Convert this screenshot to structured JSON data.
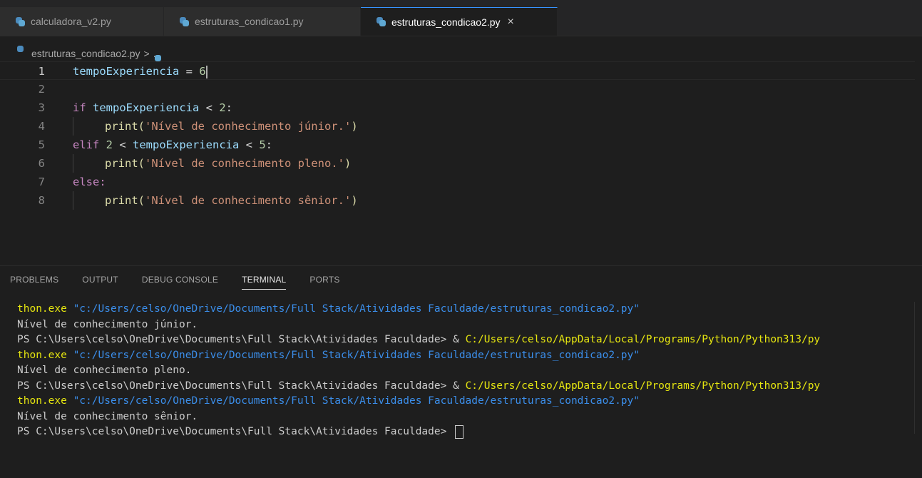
{
  "tabs": [
    {
      "label": "calculadora_v2.py",
      "active": false
    },
    {
      "label": "estruturas_condicao1.py",
      "active": false
    },
    {
      "label": "estruturas_condicao2.py",
      "active": true
    }
  ],
  "close_icon": "×",
  "breadcrumb": {
    "file": "estruturas_condicao2.py",
    "separator": ">",
    "rest": "..."
  },
  "editor": {
    "line_numbers": [
      "1",
      "2",
      "3",
      "4",
      "5",
      "6",
      "7",
      "8"
    ],
    "lines": [
      {
        "var": "tempoExperiencia",
        "op": " = ",
        "num": "6"
      },
      {},
      {
        "kw": "if",
        "var": "tempoExperiencia",
        "op": " < ",
        "num": "2",
        "end": ":"
      },
      {
        "fn": "print",
        "str": "'Nível de conhecimento júnior.'"
      },
      {
        "kw": "elif",
        "num1": "2",
        "op1": " < ",
        "var": "tempoExperiencia",
        "op2": " < ",
        "num2": "5",
        "end": ":"
      },
      {
        "fn": "print",
        "str": "'Nível de conhecimento pleno.'"
      },
      {
        "kw": "else",
        "end": ":"
      },
      {
        "fn": "print",
        "str": "'Nível de conhecimento sênior.'"
      }
    ]
  },
  "panel": {
    "tabs": [
      "PROBLEMS",
      "OUTPUT",
      "DEBUG CONSOLE",
      "TERMINAL",
      "PORTS"
    ],
    "active_tab": "TERMINAL"
  },
  "terminal": {
    "cont_cmd": "thon.exe",
    "script_path": "\"c:/Users/celso/OneDrive/Documents/Full Stack/Atividades Faculdade/estruturas_condicao2.py\"",
    "prompt": "PS C:\\Users\\celso\\OneDrive\\Documents\\Full Stack\\Atividades Faculdade> ",
    "amp": "& ",
    "python_path": "C:/Users/celso/AppData/Local/Programs/Python/Python313/py",
    "output_junior": "Nível de conhecimento júnior.",
    "output_pleno": "Nível de conhecimento pleno.",
    "output_senior": "Nível de conhecimento sênior."
  },
  "colors": {
    "keyword": "#c586c0",
    "variable": "#9cdcfe",
    "number": "#b5cea8",
    "function": "#dcdcaa",
    "string": "#ce9178",
    "terminal_command": "#e5e510",
    "terminal_path": "#3b8eea"
  }
}
